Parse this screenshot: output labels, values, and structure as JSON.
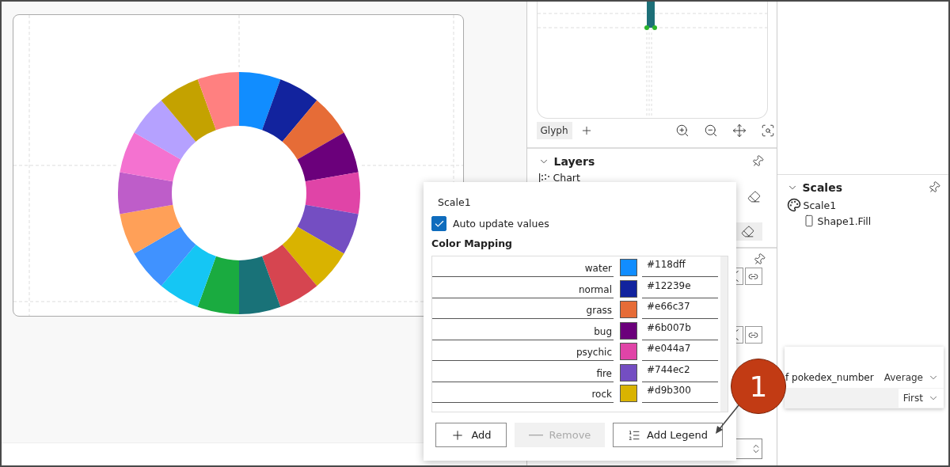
{
  "glyph_editor": {
    "tab": "Glyph"
  },
  "layers": {
    "title": "Layers",
    "items": [
      {
        "label": "Chart"
      }
    ]
  },
  "scales": {
    "title": "Scales",
    "items": [
      {
        "label": "Scale1",
        "children": [
          {
            "label": "Shape1.Fill"
          }
        ]
      }
    ]
  },
  "popup": {
    "title": "Scale1",
    "auto_update": {
      "label": "Auto update values",
      "checked": true
    },
    "section": "Color Mapping",
    "mappings": [
      {
        "name": "water",
        "color": "#118dff",
        "value": "#118dff"
      },
      {
        "name": "normal",
        "color": "#12239e",
        "value": "#12239e"
      },
      {
        "name": "grass",
        "color": "#e66c37",
        "value": "#e66c37"
      },
      {
        "name": "bug",
        "color": "#6b007b",
        "value": "#6b007b"
      },
      {
        "name": "psychic",
        "color": "#e044a7",
        "value": "#e044a7"
      },
      {
        "name": "fire",
        "color": "#744ec2",
        "value": "#744ec2"
      },
      {
        "name": "rock",
        "color": "#d9b300",
        "value": "#d9b300"
      }
    ],
    "buttons": [
      {
        "kind": "add",
        "label": "Add",
        "disabled": false
      },
      {
        "kind": "remove",
        "label": "Remove",
        "disabled": true
      },
      {
        "kind": "legend",
        "label": "Add Legend",
        "disabled": false
      }
    ]
  },
  "dropdown": {
    "rows": [
      {
        "label": "f pokedex_number",
        "value": "Average"
      },
      {
        "value": "First"
      }
    ]
  },
  "callout": {
    "number": "1"
  }
}
